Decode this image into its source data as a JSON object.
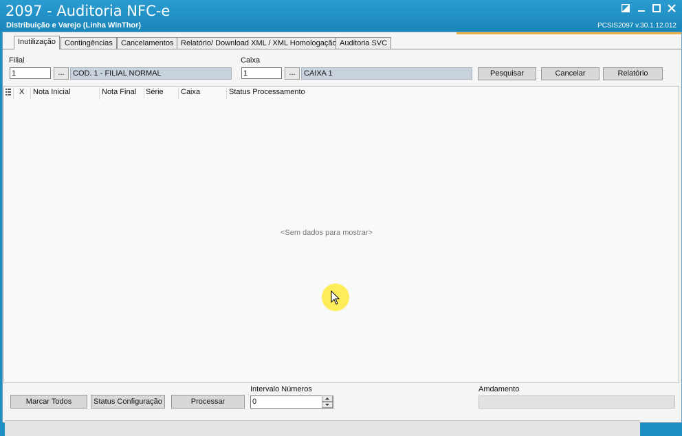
{
  "window": {
    "title": "2097 - Auditoria NFC-e",
    "subtitle": "Distribuição e Varejo (Linha WinThor)",
    "version": "PCSIS2097  v.30.1.12.012",
    "controls": [
      "restore-icon",
      "minimize-icon",
      "maximize-icon",
      "close-icon"
    ]
  },
  "tabs": [
    "Inutilização",
    "Contingências",
    "Cancelamentos",
    "Relatório/ Download XML / XML Homologação",
    "Auditoria SVC"
  ],
  "filters": {
    "filial_label": "Filial",
    "filial_value": "1",
    "filial_desc": "COD. 1 - FILIAL NORMAL",
    "caixa_label": "Caixa",
    "caixa_value": "1",
    "caixa_desc": "CAIXA 1",
    "lookup_label": "..."
  },
  "actions": {
    "pesquisar": "Pesquisar",
    "cancelar": "Cancelar",
    "relatorio": "Relatório"
  },
  "grid": {
    "columns": [
      "X",
      "Nota Inicial",
      "Nota Final",
      "Série",
      "Caixa",
      "Status Processamento"
    ],
    "empty_text": "<Sem dados para mostrar>"
  },
  "footer": {
    "marcar_todos": "Marcar Todos",
    "status_config": "Status Configuração",
    "processar": "Processar",
    "intervalo_label": "Intervalo Números",
    "intervalo_value": "0",
    "andamento_label": "Amdamento"
  }
}
